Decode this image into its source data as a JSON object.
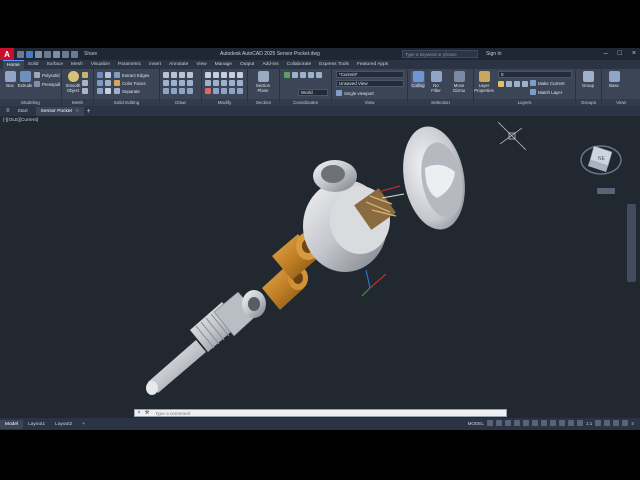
{
  "app": {
    "logo_letter": "A",
    "window_title": "Autodesk AutoCAD 2025   Sensor Pocket.dwg",
    "share_label": "Share",
    "search_placeholder": "Type a keyword or phrase",
    "sign_in": "Sign In"
  },
  "ribbon_tabs": [
    "Home",
    "Solid",
    "Surface",
    "Mesh",
    "Visualize",
    "Parametric",
    "Insert",
    "Annotate",
    "View",
    "Manage",
    "Output",
    "Add-ins",
    "Collaborate",
    "Express Tools",
    "Featured Apps"
  ],
  "ribbon": {
    "modeling": {
      "label": "Modeling",
      "box": "Box",
      "extrude": "Extrude",
      "polysolid": "Polysolid",
      "presspull": "Presspull"
    },
    "mesh": {
      "label": "Mesh",
      "smooth_object": "Smooth Object"
    },
    "solid_editing": {
      "label": "Solid Editing",
      "extract_edges": "Extract Edges",
      "color_faces": "Color Faces",
      "separate": "Separate"
    },
    "draw": {
      "label": "Draw"
    },
    "modify": {
      "label": "Modify"
    },
    "section": {
      "label": "Section",
      "section_plane": "Section Plane"
    },
    "coordinates": {
      "label": "Coordinates",
      "world": "World"
    },
    "view": {
      "label": "View",
      "current": "*Current*",
      "unsaved_view": "Unsaved View",
      "single_viewport": "Single viewport"
    },
    "selection": {
      "label": "Selection",
      "culling": "Culling",
      "no_filter": "No Filter",
      "move_gizmo": "Move Gizmo"
    },
    "layers": {
      "label": "Layers",
      "layer_properties": "Layer Properties",
      "layer_value": "0",
      "make_current": "Make Current",
      "match_layer": "Match Layer"
    },
    "groups": {
      "label": "Groups",
      "group": "Group"
    },
    "view2": {
      "label": "View",
      "base": "Base"
    }
  },
  "file_tabs": [
    {
      "label": "Start"
    },
    {
      "label": "Sensor Pocket",
      "close": "×"
    }
  ],
  "viewport": {
    "label": "[-][Custom View][Realistic]",
    "label_visible": "[-][OLE][Current]",
    "viewcube_face": "NE"
  },
  "command_line": {
    "prompt": "Type a command"
  },
  "layout_tabs": [
    "Model",
    "Layout1",
    "Layout2"
  ],
  "status": {
    "model": "MODEL",
    "scale": "1:1"
  },
  "colors": {
    "accent": "#4f9bff",
    "brass": "#c98a2e",
    "steel": "#c8cbd0",
    "background": "#212830"
  }
}
